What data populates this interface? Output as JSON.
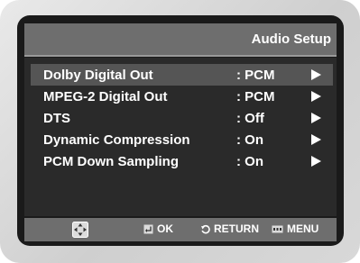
{
  "header": {
    "title": "Audio Setup"
  },
  "menu": {
    "items": [
      {
        "label": "Dolby Digital Out",
        "value": ": PCM",
        "arrow": "right-arrow-icon"
      },
      {
        "label": "MPEG-2 Digital Out",
        "value": ": PCM",
        "arrow": "right-arrow-icon"
      },
      {
        "label": "DTS",
        "value": ": Off",
        "arrow": "right-arrow-icon"
      },
      {
        "label": "Dynamic Compression",
        "value": ": On",
        "arrow": "right-arrow-icon"
      },
      {
        "label": "PCM Down Sampling",
        "value": ": On",
        "arrow": "right-arrow-icon"
      }
    ],
    "selected_index": 0
  },
  "footer": {
    "nav_icon": "directional-pad-icon",
    "ok_label": "OK",
    "return_label": "RETURN",
    "menu_label": "MENU"
  },
  "colors": {
    "header_bg": "#6e6e6e",
    "content_bg": "#2a2a2a",
    "selected_row_bg": "#555555",
    "text": "#ffffff"
  }
}
